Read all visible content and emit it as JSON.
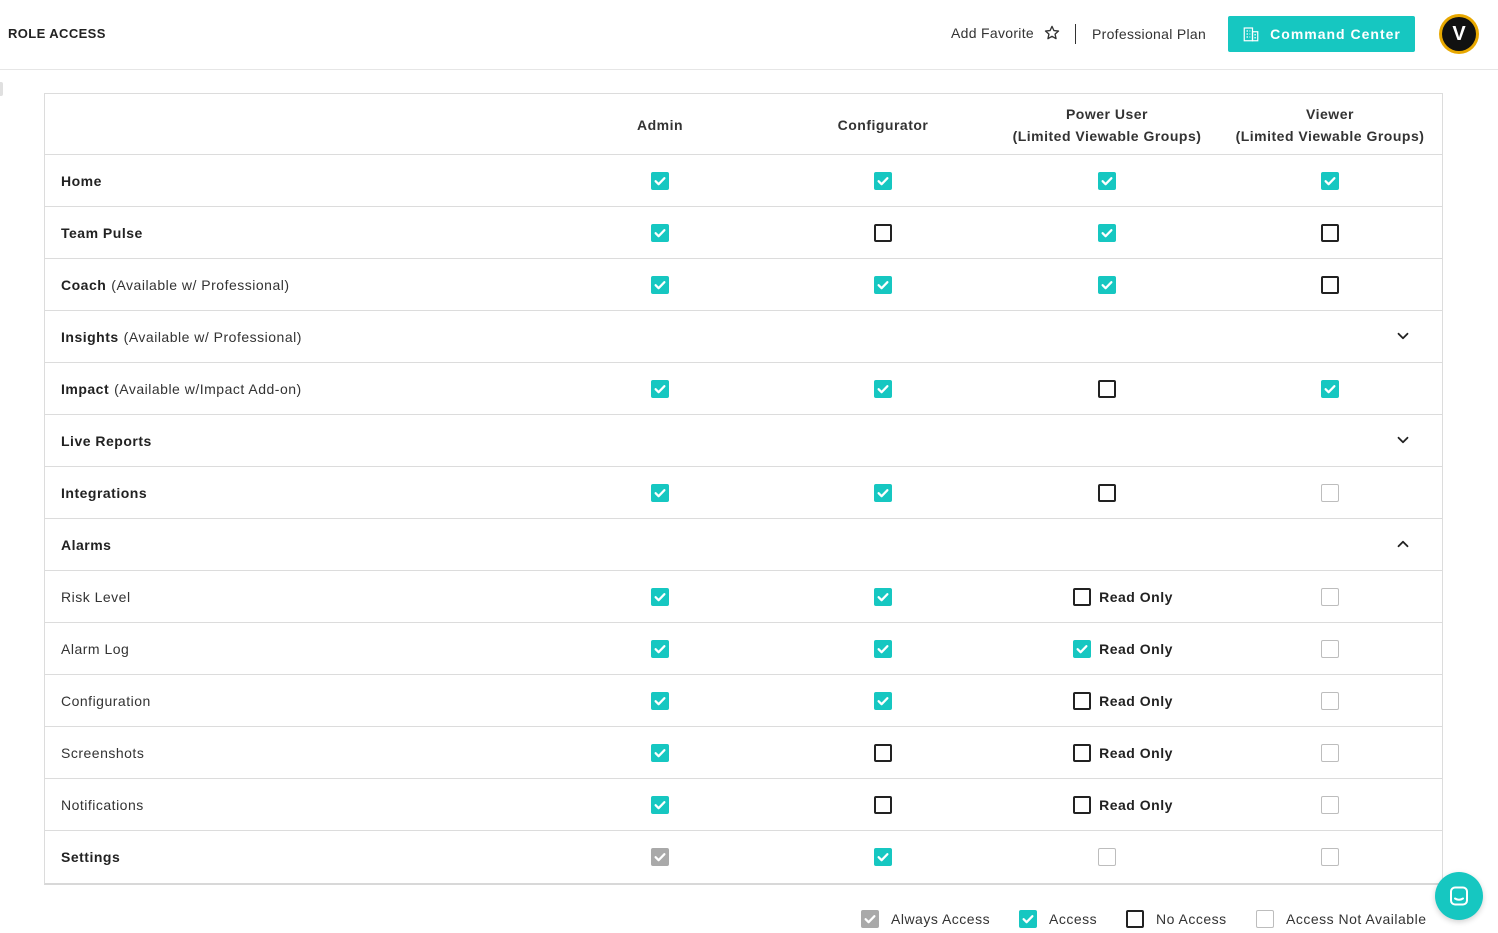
{
  "header": {
    "title": "ROLE ACCESS",
    "add_favorite": "Add Favorite",
    "plan": "Professional Plan",
    "command_center": "Command Center",
    "avatar_initial": "V"
  },
  "table": {
    "columns": [
      {
        "label": "Admin"
      },
      {
        "label": "Configurator"
      },
      {
        "label": "Power User\n(Limited Viewable Groups)"
      },
      {
        "label": "Viewer\n(Limited Viewable Groups)"
      }
    ],
    "rows": [
      {
        "label": "Home",
        "note": "",
        "bold": true,
        "cells": [
          "access",
          "access",
          "access",
          "access"
        ]
      },
      {
        "label": "Team Pulse",
        "note": "",
        "bold": true,
        "cells": [
          "access",
          "none",
          "access",
          "none"
        ]
      },
      {
        "label": "Coach",
        "note": "(Available w/ Professional)",
        "bold": true,
        "cells": [
          "access",
          "access",
          "access",
          "none"
        ]
      },
      {
        "label": "Insights",
        "note": "(Available w/ Professional)",
        "bold": true,
        "expander": "down"
      },
      {
        "label": "Impact",
        "note": "(Available w/Impact Add-on)",
        "bold": true,
        "cells": [
          "access",
          "access",
          "none",
          "access"
        ]
      },
      {
        "label": "Live Reports",
        "note": "",
        "bold": true,
        "expander": "down"
      },
      {
        "label": "Integrations",
        "note": "",
        "bold": true,
        "cells": [
          "access",
          "access",
          "none",
          "na"
        ]
      },
      {
        "label": "Alarms",
        "note": "",
        "bold": true,
        "expander": "up"
      },
      {
        "label": "Risk Level",
        "note": "",
        "bold": false,
        "cells": [
          "access",
          "access",
          "none",
          "na"
        ],
        "read_only": "Read Only"
      },
      {
        "label": "Alarm Log",
        "note": "",
        "bold": false,
        "cells": [
          "access",
          "access",
          "access",
          "na"
        ],
        "read_only": "Read Only"
      },
      {
        "label": "Configuration",
        "note": "",
        "bold": false,
        "cells": [
          "access",
          "access",
          "none",
          "na"
        ],
        "read_only": "Read Only"
      },
      {
        "label": "Screenshots",
        "note": "",
        "bold": false,
        "cells": [
          "access",
          "none",
          "none",
          "na"
        ],
        "read_only": "Read Only"
      },
      {
        "label": "Notifications",
        "note": "",
        "bold": false,
        "cells": [
          "access",
          "none",
          "none",
          "na"
        ],
        "read_only": "Read Only"
      },
      {
        "label": "Settings",
        "note": "",
        "bold": true,
        "cells": [
          "always",
          "access",
          "na",
          "na"
        ]
      }
    ]
  },
  "legend": [
    {
      "state": "always",
      "label": "Always Access"
    },
    {
      "state": "access",
      "label": "Access"
    },
    {
      "state": "none",
      "label": "No Access"
    },
    {
      "state": "na",
      "label": "Access Not Available"
    }
  ],
  "colors": {
    "accent": "#16c7c1",
    "always_access": "#a9a9a9",
    "avatar_ring": "#e8a800"
  },
  "icons": {
    "favorite": "star-outline-icon",
    "command_center": "building-icon",
    "expand": "chevron-down-icon",
    "collapse": "chevron-up-icon",
    "chat": "chat-icon"
  }
}
